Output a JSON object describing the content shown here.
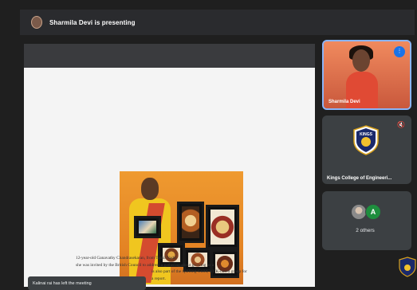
{
  "presentation": {
    "banner_label": "Sharmila Devi is presenting"
  },
  "slide": {
    "caption_lines": [
      "12-year-old Ganavathy Chandrasekaran, from Tamil Nadu",
      "she was invited by the British Council to address a gathering about growing as a",
      "is also part of the Quilling Guild, a UK-based group for",
      "a report."
    ]
  },
  "participants": [
    {
      "name": "Sharmila Devi"
    },
    {
      "name": "Kings College of Engineeri..."
    },
    {
      "name": "2 others",
      "avatar_letter": "A"
    }
  ],
  "toast": {
    "message": "Kalinai rai has left the meeting"
  },
  "logos": {
    "college_text": "KINGS"
  },
  "colors": {
    "active_border": "#8ab4f8",
    "tile_bg": "#3c4043",
    "avatar_green": "#1e8e3e",
    "speaking_blue": "#1a73e8"
  }
}
